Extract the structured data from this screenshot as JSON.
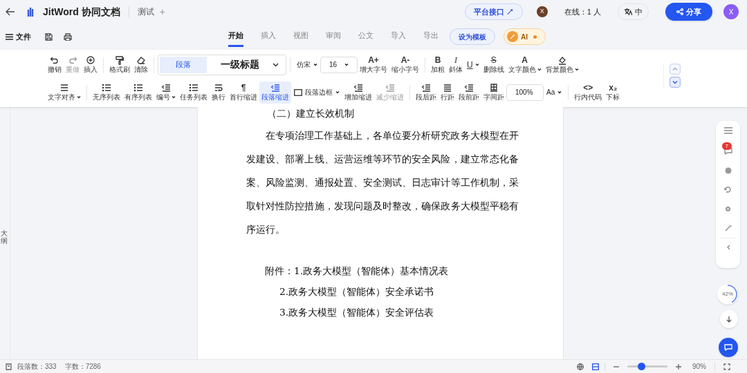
{
  "app": {
    "title": "JitWord 协同文档",
    "doc_tab": "测试",
    "new_tab": "+"
  },
  "header_right": {
    "api_button": "平台接口 ↗",
    "collaborator": "X",
    "online": "在线：1 人",
    "language": {
      "label": "中"
    },
    "share": "分享",
    "user": "X"
  },
  "menu": {
    "file": "文件",
    "tabs": [
      {
        "label": "开始",
        "selected": true
      },
      {
        "label": "插入",
        "selected": false
      },
      {
        "label": "视图",
        "selected": false
      },
      {
        "label": "审阅",
        "selected": false
      },
      {
        "label": "公文",
        "selected": false
      },
      {
        "label": "导入",
        "selected": false
      },
      {
        "label": "导出",
        "selected": false
      }
    ],
    "template_button": "设为模板",
    "ai_button": "AI"
  },
  "toolbar": {
    "rows": [
      {
        "groups": [
          {
            "items": [
              {
                "kind": "tool",
                "label": "撤销",
                "disabled": false
              },
              {
                "kind": "tool",
                "label": "重做",
                "disabled": true
              },
              {
                "kind": "tool",
                "label": "插入",
                "disabled": false
              }
            ]
          },
          {
            "items": [
              {
                "kind": "tool",
                "label": "格式刷",
                "disabled": false
              },
              {
                "kind": "tool",
                "label": "清除",
                "disabled": false
              }
            ]
          },
          {
            "items": [
              {
                "kind": "style",
                "paragraph": "段落",
                "heading": "一级标题"
              }
            ]
          },
          {
            "items": [
              {
                "kind": "select",
                "value": "仿宋",
                "boxed": false
              },
              {
                "kind": "select",
                "value": "16",
                "boxed": true
              },
              {
                "kind": "tool",
                "glyph": "A+",
                "label": "增大字号",
                "disabled": false
              },
              {
                "kind": "tool",
                "glyph": "A-",
                "label": "缩小字号",
                "disabled": false
              }
            ]
          },
          {
            "items": [
              {
                "kind": "tool",
                "glyph": "B",
                "label": "加粗",
                "disabled": false
              },
              {
                "kind": "tool",
                "glyph": "I",
                "label": "斜体",
                "disabled": false
              },
              {
                "kind": "tool",
                "glyph": "U",
                "dropdown": true,
                "disabled": false
              },
              {
                "kind": "tool",
                "glyph": "S",
                "label": "删除线",
                "disabled": false
              },
              {
                "kind": "tool",
                "glyph": "A",
                "label": "文字颜色",
                "dropdown": true,
                "disabled": false
              },
              {
                "kind": "tool",
                "label": "背景颜色",
                "dropdown": true,
                "disabled": false
              }
            ]
          }
        ]
      },
      {
        "groups": [
          {
            "items": [
              {
                "kind": "tool",
                "label": "文字对齐",
                "dropdown": true,
                "disabled": false
              }
            ]
          },
          {
            "items": [
              {
                "kind": "tool",
                "label": "无序列表",
                "disabled": false
              },
              {
                "kind": "tool",
                "label": "有序列表",
                "disabled": false
              },
              {
                "kind": "tool",
                "label": "编号",
                "dropdown": true,
                "disabled": false
              },
              {
                "kind": "tool",
                "label": "任务列表",
                "disabled": false
              },
              {
                "kind": "tool",
                "label": "换行",
                "disabled": false
              },
              {
                "kind": "tool",
                "glyph": "¶",
                "label": "首行缩进",
                "disabled": false
              },
              {
                "kind": "tool",
                "label": "段落缩进",
                "active": true,
                "disabled": false
              },
              {
                "kind": "inline",
                "label": "段落边框",
                "dropdown": true
              },
              {
                "kind": "tool",
                "label": "增加缩进",
                "disabled": false
              },
              {
                "kind": "tool",
                "label": "减少缩进",
                "disabled": true
              }
            ]
          },
          {
            "items": [
              {
                "kind": "tool",
                "label": "段后距",
                "disabled": false
              },
              {
                "kind": "tool",
                "label": "行距",
                "disabled": false
              },
              {
                "kind": "tool",
                "label": "段前距",
                "disabled": false
              },
              {
                "kind": "tool",
                "label": "字间距",
                "disabled": false
              },
              {
                "kind": "select",
                "value": "100%",
                "boxed": true
              },
              {
                "kind": "select",
                "value": "Aa",
                "boxed": false
              }
            ]
          },
          {
            "items": [
              {
                "kind": "tool",
                "glyph": "<>",
                "label": "行内代码",
                "disabled": false
              },
              {
                "kind": "tool",
                "glyph": "x₂",
                "label": "下标",
                "disabled": false
              }
            ]
          }
        ]
      }
    ]
  },
  "outline_tab": "大纲",
  "document": {
    "heading": "（二）建立长效机制",
    "paragraph": "在专项治理工作基础上，各单位要分析研究政务大模型在开发建设、部署上线、运营运维等环节的安全风险，建立常态化备案、风险监测、通报处置、安全测试、日志审计等工作机制，采取针对性防控措施，发现问题及时整改，确保政务大模型平稳有序运行。",
    "attachments": [
      "附件：1.政务大模型（智能体）基本情况表",
      "2.政务大模型（智能体）安全承诺书",
      "3.政务大模型（智能体）安全评估表"
    ]
  },
  "side_panel": {
    "comment_count": "7",
    "progress": {
      "reading": "42%"
    }
  },
  "status_bar": {
    "paragraphs": "段落数：333",
    "words": "字数：7286",
    "layout_active": true,
    "zoom": {
      "level": 0.35,
      "reading": "90%"
    }
  }
}
